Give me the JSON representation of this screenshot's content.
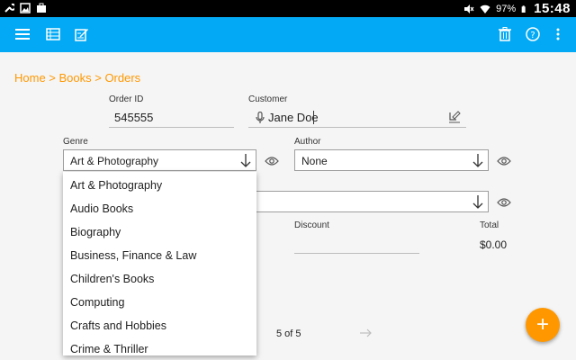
{
  "status_bar": {
    "battery": "97%",
    "time": "15:48",
    "left_icons": [
      "wrench-icon",
      "image-icon",
      "briefcase-icon"
    ],
    "right_icons": [
      "mute-icon",
      "wifi-icon",
      "battery-icon"
    ]
  },
  "app_bar": {
    "color": "#03a9f4",
    "left_icons": [
      "menu-icon",
      "table-icon",
      "edit-icon"
    ],
    "right_icons": [
      "trash-icon",
      "help-icon",
      "more-vert-icon"
    ]
  },
  "breadcrumb": "Home > Books > Orders",
  "form": {
    "order_id": {
      "label": "Order ID",
      "value": "545555"
    },
    "customer": {
      "label": "Customer",
      "value": "Jane Doe"
    },
    "genre": {
      "label": "Genre",
      "value": "Art & Photography"
    },
    "author": {
      "label": "Author",
      "value": "None"
    },
    "discount": {
      "label": "Discount",
      "value": ""
    },
    "total": {
      "label": "Total",
      "value": "$0.00"
    }
  },
  "genre_options": [
    "Art & Photography",
    "Audio Books",
    "Biography",
    "Business, Finance & Law",
    "Children's Books",
    "Computing",
    "Crafts and Hobbies",
    "Crime & Thriller"
  ],
  "pagination": {
    "text": "5 of 5"
  },
  "accent_color": "#ff9800"
}
